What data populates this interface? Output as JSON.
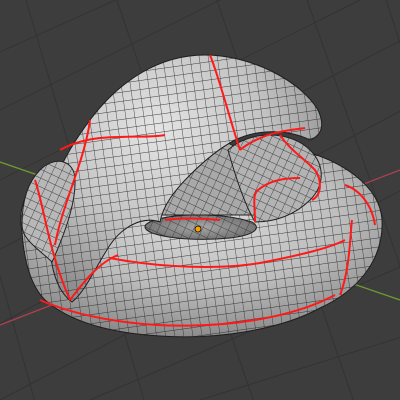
{
  "viewport": {
    "background_color": "#3d3d3d",
    "grid_line_color": "#333333",
    "x_axis_color": "#a8424f",
    "y_axis_color": "#6e9a30"
  },
  "object": {
    "type": "knotted-torus-mesh",
    "surface_color": "#b9b9b9",
    "wire_color": "#1e1e1e",
    "seam_color": "#ff1a1a",
    "origin_color": "#ffa000"
  },
  "icons": [
    "object-origin-icon"
  ]
}
